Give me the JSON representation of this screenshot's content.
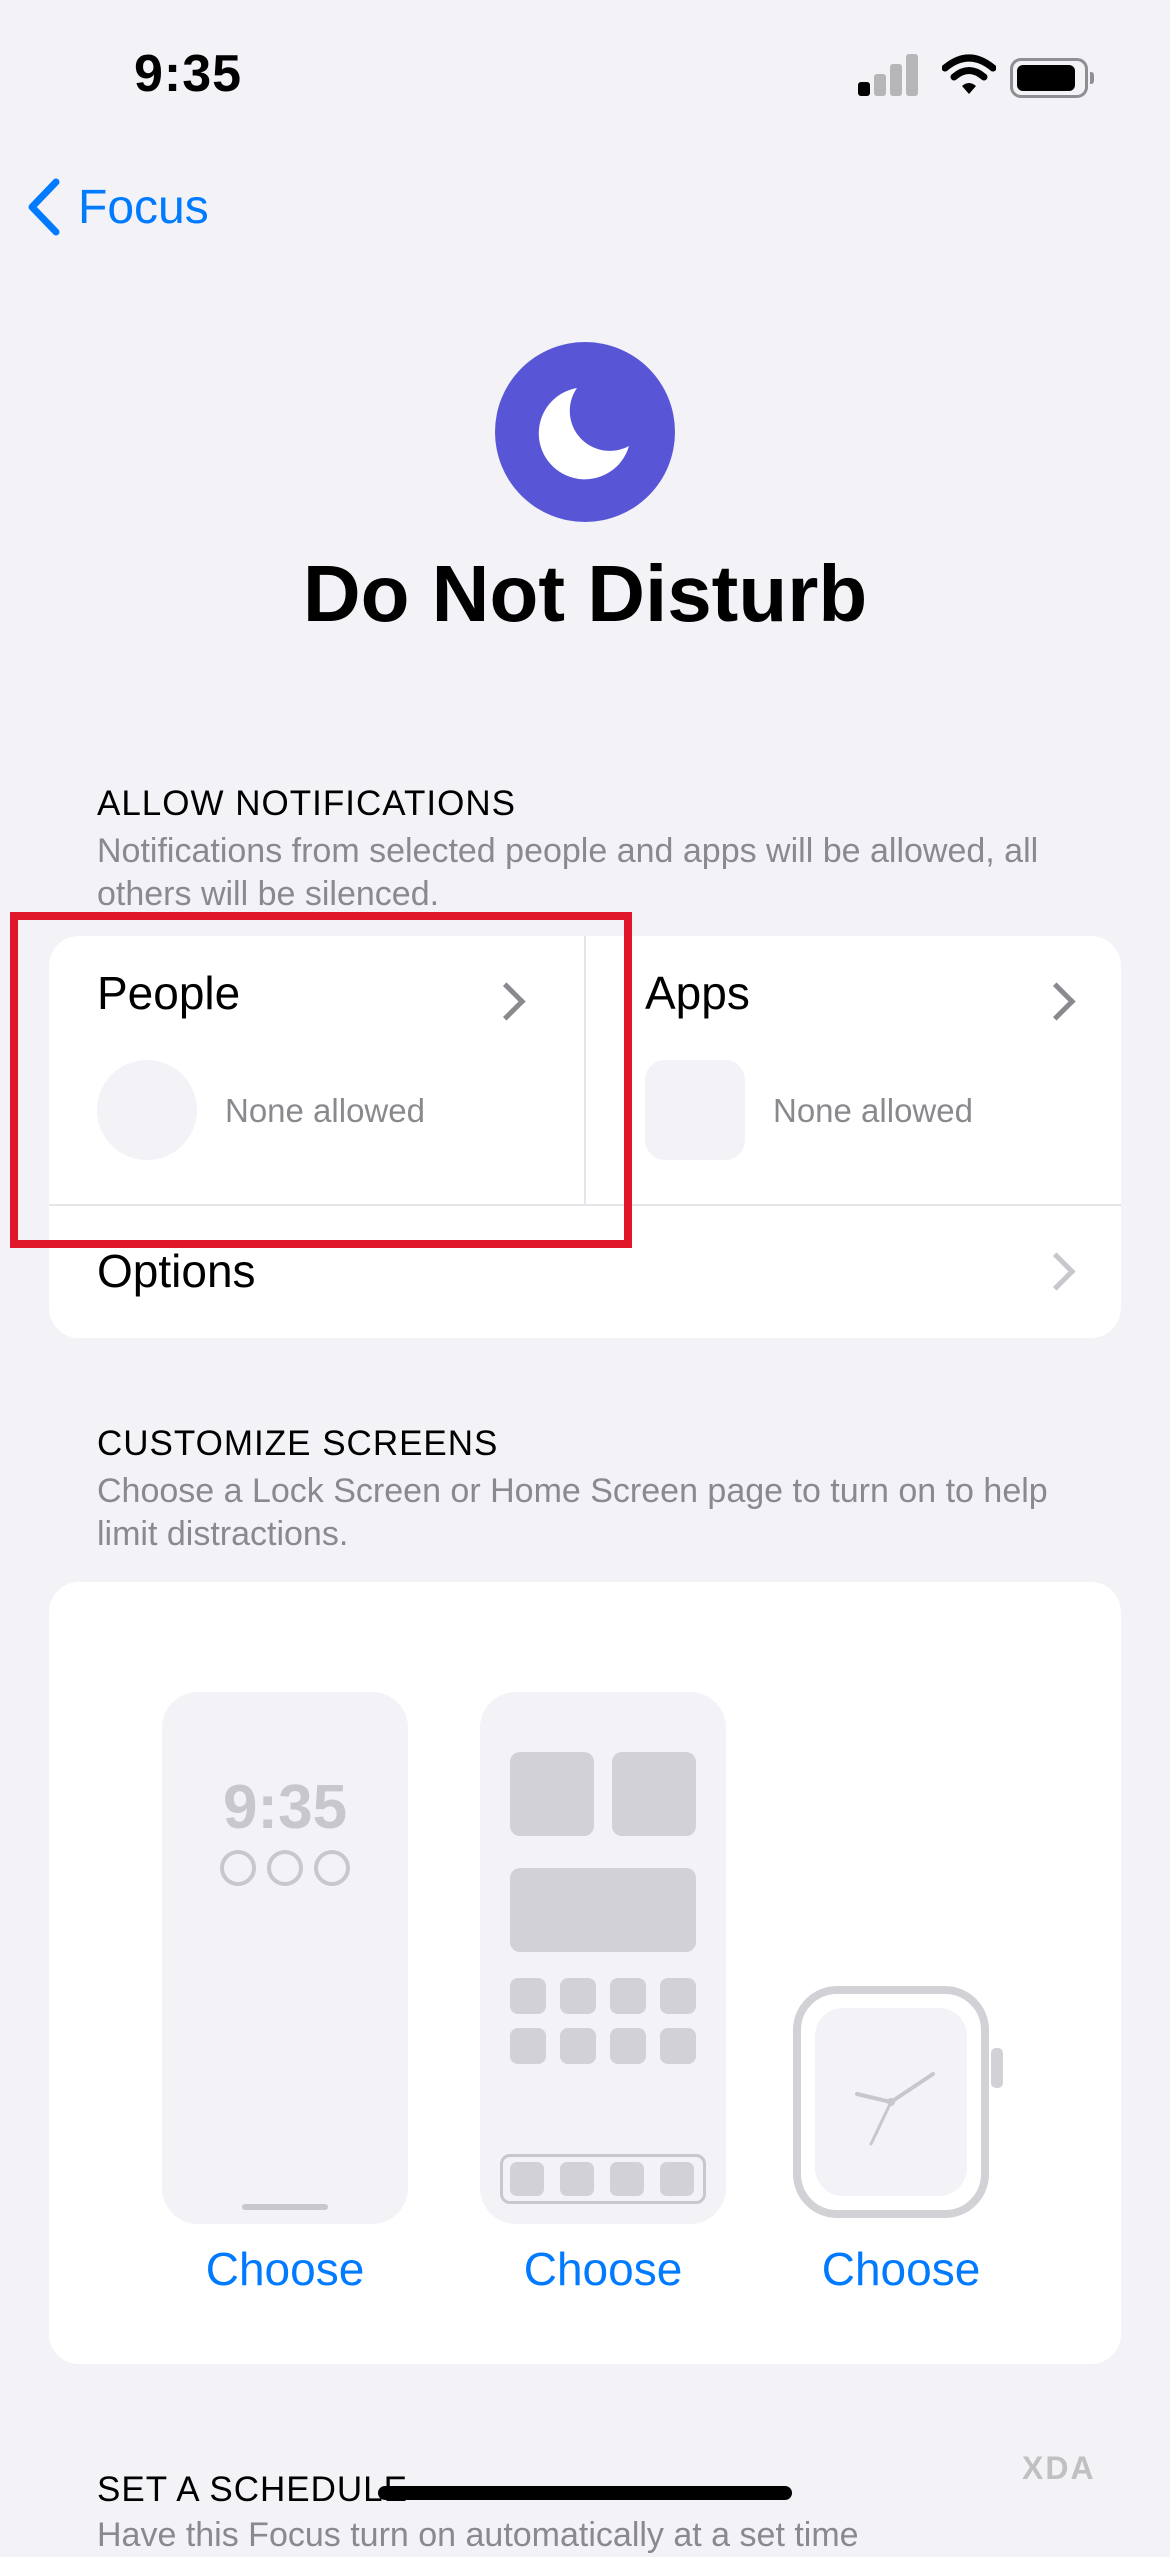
{
  "status_bar": {
    "time": "9:35"
  },
  "nav": {
    "back_label": "Focus"
  },
  "header": {
    "title": "Do Not Disturb",
    "icon": "moon-icon",
    "icon_color": "#5856d6"
  },
  "allow_notifications": {
    "heading": "ALLOW NOTIFICATIONS",
    "description": "Notifications from selected people and apps will be allowed, all others will be silenced.",
    "people": {
      "label": "People",
      "value": "None allowed"
    },
    "apps": {
      "label": "Apps",
      "value": "None allowed"
    },
    "options": {
      "label": "Options"
    }
  },
  "customize_screens": {
    "heading": "CUSTOMIZE SCREENS",
    "description": "Choose a Lock Screen or Home Screen page to turn on to help limit distractions.",
    "lock_screen_time": "9:35",
    "choices": [
      "Choose",
      "Choose",
      "Choose"
    ]
  },
  "schedule": {
    "heading": "SET A SCHEDULE",
    "description": "Have this Focus turn on automatically at a set time"
  },
  "watermark": "XDA",
  "colors": {
    "accent": "#007aff",
    "highlight": "#e0162b",
    "background": "#f2f2f7"
  }
}
